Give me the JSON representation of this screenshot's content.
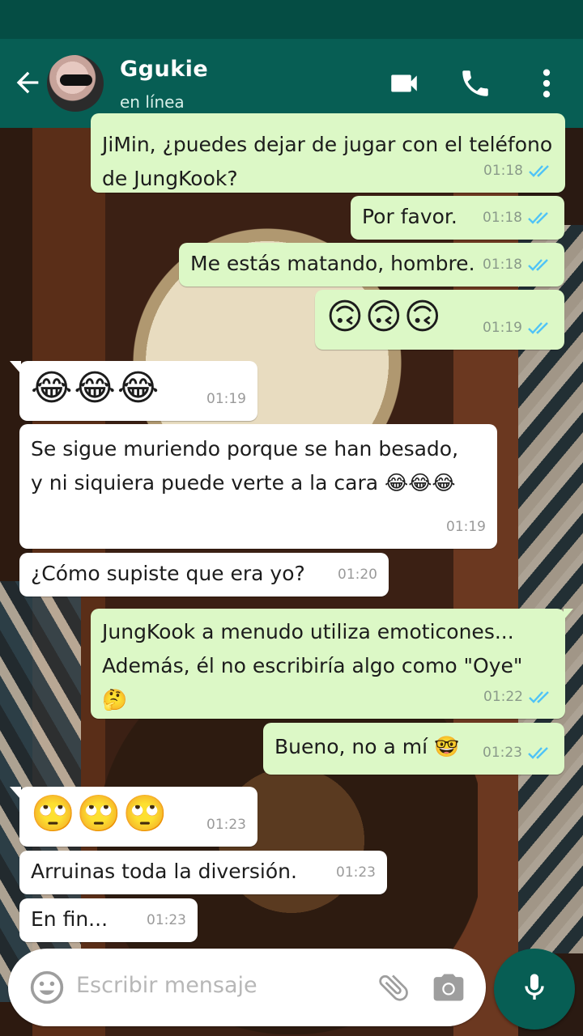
{
  "header": {
    "contact_name": "Ggukie",
    "status": "en línea",
    "icons": [
      "back-arrow-icon",
      "video-call-icon",
      "phone-icon",
      "more-options-icon"
    ]
  },
  "messages": [
    {
      "dir": "out",
      "text": "JiMin, ¿puedes dejar de jugar con el teléfono de JungKook?",
      "time": "01:18",
      "ticks": "read"
    },
    {
      "dir": "out",
      "text": "Por favor.",
      "time": "01:18",
      "ticks": "read"
    },
    {
      "dir": "out",
      "text": "Me estás matando, hombre.",
      "time": "01:18",
      "ticks": "read"
    },
    {
      "dir": "out",
      "text": "🙃🙃🙃",
      "time": "01:19",
      "ticks": "read"
    },
    {
      "dir": "in",
      "text": "😂😂😂",
      "time": "01:19"
    },
    {
      "dir": "in",
      "text": "Se sigue muriendo porque se han besado, y ni siquiera puede verte a la cara 😂😂😂",
      "time": "01:19"
    },
    {
      "dir": "in",
      "text": "¿Cómo supiste que era yo?",
      "time": "01:20"
    },
    {
      "dir": "out",
      "text": "JungKook a menudo utiliza emoticones... Además, él no escribiría algo como \"Oye\" 🤔",
      "time": "01:22",
      "ticks": "read"
    },
    {
      "dir": "out",
      "text": "Bueno, no a mí 🤓",
      "time": "01:23",
      "ticks": "read"
    },
    {
      "dir": "in",
      "text": "🙄🙄🙄",
      "time": "01:23"
    },
    {
      "dir": "in",
      "text": "Arruinas toda la diversión.",
      "time": "01:23"
    },
    {
      "dir": "in",
      "text": "En fin...",
      "time": "01:23"
    }
  ],
  "composer": {
    "placeholder": "Escribir mensaje",
    "icons": [
      "emoji-icon",
      "attach-icon",
      "camera-icon",
      "mic-icon"
    ]
  },
  "colors": {
    "appbar": "#075e54",
    "statusbar": "#054d44",
    "outgoing_bubble": "#dcf8c6",
    "incoming_bubble": "#ffffff",
    "read_ticks": "#4fc3f7"
  }
}
